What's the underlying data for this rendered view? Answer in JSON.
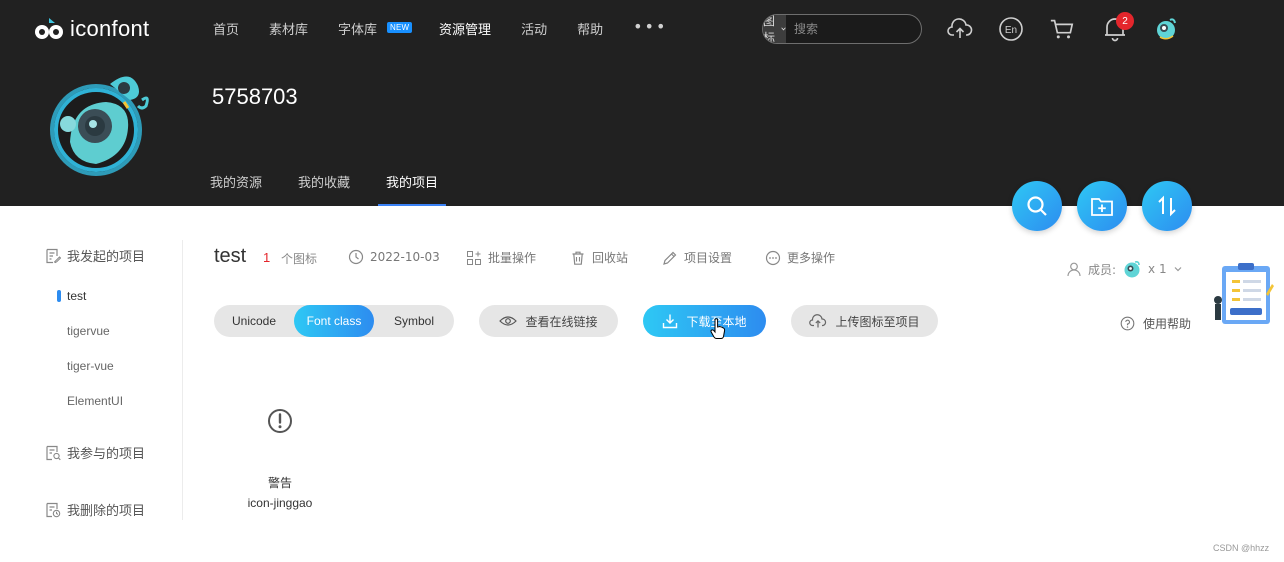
{
  "brand": {
    "name": "iconfont"
  },
  "nav": {
    "items": [
      {
        "label": "首页",
        "active": false
      },
      {
        "label": "素材库",
        "active": false
      },
      {
        "label": "字体库",
        "active": false,
        "badge": "NEW"
      },
      {
        "label": "资源管理",
        "active": true
      },
      {
        "label": "活动",
        "active": false
      },
      {
        "label": "帮助",
        "active": false
      }
    ],
    "more": "•••"
  },
  "search": {
    "type": "图标",
    "placeholder": "搜索"
  },
  "header_icons": [
    "upload-icon",
    "language-en-icon",
    "cart-icon",
    "bell-icon",
    "user-avatar"
  ],
  "notifications": {
    "count": "2"
  },
  "profile": {
    "name": "5758703",
    "tabs": [
      {
        "label": "我的资源",
        "active": false
      },
      {
        "label": "我的收藏",
        "active": false
      },
      {
        "label": "我的项目",
        "active": true
      }
    ]
  },
  "sidebar": {
    "created": {
      "label": "我发起的项目",
      "projects": [
        "test",
        "tigervue",
        "tiger-vue",
        "ElementUI"
      ],
      "active": "test"
    },
    "joined": {
      "label": "我参与的项目"
    },
    "deleted": {
      "label": "我删除的项目"
    }
  },
  "project": {
    "title": "test",
    "icon_count": "1",
    "icon_count_label": "个图标",
    "date": "2022-10-03",
    "actions": [
      "批量操作",
      "回收站",
      "项目设置",
      "更多操作"
    ],
    "members_label": "成员:",
    "members_count": "x 1"
  },
  "toolbar": {
    "formats": [
      {
        "label": "Unicode",
        "active": false
      },
      {
        "label": "Font class",
        "active": true
      },
      {
        "label": "Symbol",
        "active": false
      }
    ],
    "view_online_link": "查看在线链接",
    "download_local": "下载至本地",
    "upload_icons": "上传图标至项目",
    "help": "使用帮助"
  },
  "icons": [
    {
      "name": "警告",
      "code": "icon-jinggao"
    }
  ],
  "watermark": "CSDN @hhzz",
  "colors": {
    "header_bg": "#212121",
    "accent": "#2d8cf0",
    "accent_start": "#2ec8f4",
    "badge_red": "#e4262c"
  }
}
